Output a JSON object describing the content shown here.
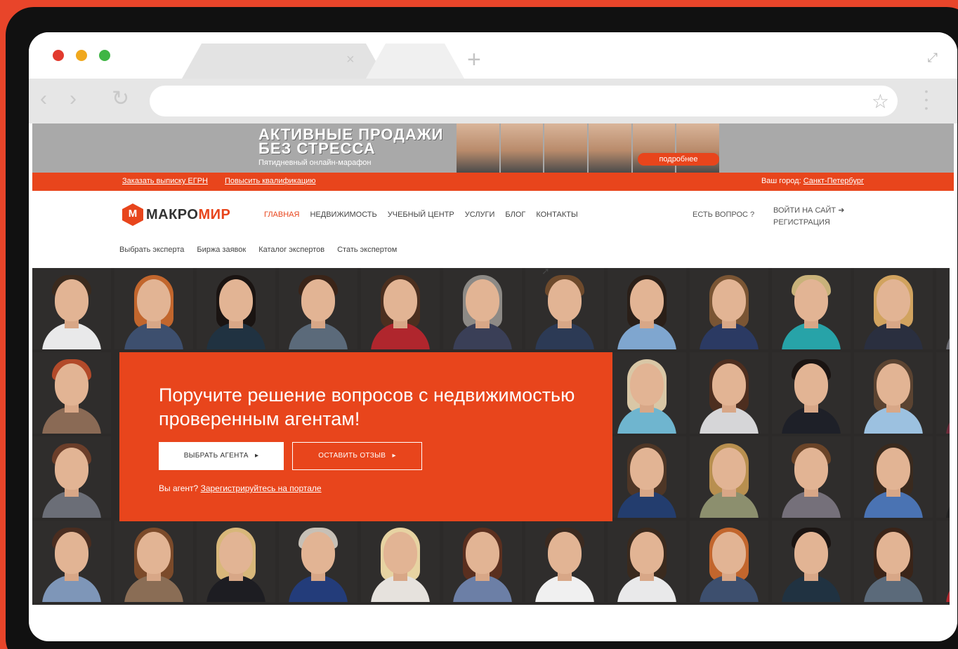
{
  "browser": {
    "tab_close": "×",
    "new_tab": "+",
    "nav_back": "‹",
    "nav_forward": "›",
    "reload": "↻",
    "bookmark": "☆"
  },
  "promo": {
    "title_line1": "АКТИВНЫЕ ПРОДАЖИ",
    "title_line2": "БЕЗ СТРЕССА",
    "subtitle": "Пятидневный онлайн-марафон",
    "more": "подробнее"
  },
  "topbar": {
    "link1": "Заказать выписку ЕГРН",
    "link2": "Повысить квалификацию",
    "city_label": "Ваш город:",
    "city_value": "Санкт-Петербург"
  },
  "header": {
    "logo_part1": "МАКРО",
    "logo_part2": "МИР",
    "nav": [
      "ГЛАВНАЯ",
      "НЕДВИЖИМОСТЬ",
      "УЧЕБНЫЙ ЦЕНТР",
      "УСЛУГИ",
      "БЛОГ",
      "КОНТАКТЫ"
    ],
    "question": "ЕСТЬ ВОПРОС",
    "login": "ВОЙТИ НА САЙТ",
    "register": "РЕГИСТРАЦИЯ"
  },
  "subnav": [
    "Выбрать эксперта",
    "Биржа заявок",
    "Каталог экспертов",
    "Стать экспертом"
  ],
  "hero": {
    "title": "Поручите решение вопросов с недвижимостью проверенным агентам!",
    "btn_agent": "ВЫБРАТЬ АГЕНТА",
    "btn_review": "ОСТАВИТЬ ОТЗЫВ",
    "note_text": "Вы агент?",
    "note_link": "Зарегистрируйтесь на портале"
  },
  "colors": {
    "brand": "#e8451c",
    "frame": "#111111",
    "background": "#e8452a"
  }
}
